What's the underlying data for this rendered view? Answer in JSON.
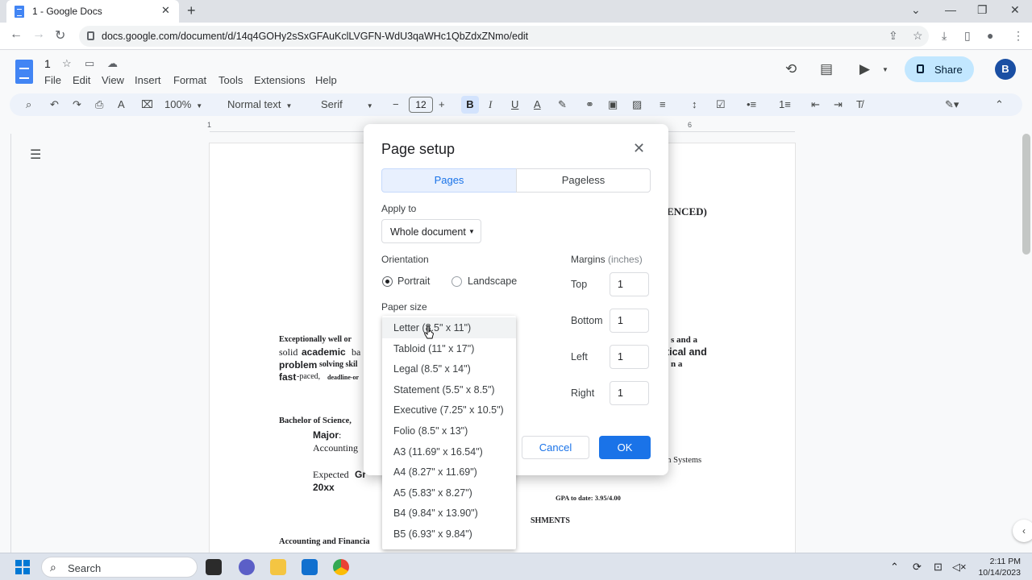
{
  "browser": {
    "tab_title": "1 - Google Docs",
    "url": "docs.google.com/document/d/14q4GOHy2sSxGFAuKclLVGFN-WdU3qaWHc1QbZdxZNmo/edit"
  },
  "docs": {
    "title": "1",
    "menu": [
      "File",
      "Edit",
      "View",
      "Insert",
      "Format",
      "Tools",
      "Extensions",
      "Help"
    ],
    "share_label": "Share",
    "avatar_letter": "B"
  },
  "toolbar": {
    "zoom": "100%",
    "style": "Normal text",
    "font": "Serif",
    "font_size": "12",
    "bold": "B",
    "italic": "I",
    "underline": "U"
  },
  "ruler": [
    "1",
    "6"
  ],
  "document": {
    "heading_fragment": "ENCED)",
    "line1_left": "Exceptionally well or",
    "line1_right": "s and a",
    "line2_left_a": "solid",
    "line2_left_b": "academic",
    "line2_left_c": "ba",
    "line2_right": "tical and",
    "line3_left_a": "problem",
    "line3_left_b": "solving skil",
    "line3_right": "n a",
    "line4_left_a": "fast",
    "line4_left_b": "-paced,",
    "line4_left_c": "deadline-or",
    "degree": "Bachelor of Science,",
    "major_label": "Major",
    "major_colon": ":",
    "major_value": "Accounting",
    "systems": "on Systems",
    "expected": "Expected",
    "expected_b": "Gr",
    "year": "20xx",
    "gpa": "GPA to date: 3.95/4.00",
    "accomplishments": "SHMENTS",
    "bottom_left": "Accounting and Financia"
  },
  "dialog": {
    "title": "Page setup",
    "tabs": [
      "Pages",
      "Pageless"
    ],
    "apply_to_label": "Apply to",
    "apply_to_value": "Whole document",
    "orientation_label": "Orientation",
    "orientation_options": [
      "Portrait",
      "Landscape"
    ],
    "orientation_selected": "Portrait",
    "paper_size_label": "Paper size",
    "margins_label": "Margins",
    "margins_unit": "(inches)",
    "margins": [
      {
        "label": "Top",
        "value": "1"
      },
      {
        "label": "Bottom",
        "value": "1"
      },
      {
        "label": "Left",
        "value": "1"
      },
      {
        "label": "Right",
        "value": "1"
      }
    ],
    "cancel_label": "Cancel",
    "ok_label": "OK"
  },
  "paper_sizes": [
    "Letter (8.5\" x 11\")",
    "Tabloid (11\" x 17\")",
    "Legal (8.5\" x 14\")",
    "Statement (5.5\" x 8.5\")",
    "Executive (7.25\" x 10.5\")",
    "Folio (8.5\" x 13\")",
    "A3 (11.69\" x 16.54\")",
    "A4 (8.27\" x 11.69\")",
    "A5 (5.83\" x 8.27\")",
    "B4 (9.84\" x 13.90\")",
    "B5 (6.93\" x 9.84\")"
  ],
  "paper_size_highlighted": "Letter (8.5\" x 11\")",
  "taskbar": {
    "search_label": "Search",
    "time": "2:11 PM",
    "date": "10/14/2023"
  },
  "colors": {
    "accent": "#1a73e8",
    "share_bg": "#c2e7ff",
    "selected_tab_bg": "#e8f0fe"
  }
}
